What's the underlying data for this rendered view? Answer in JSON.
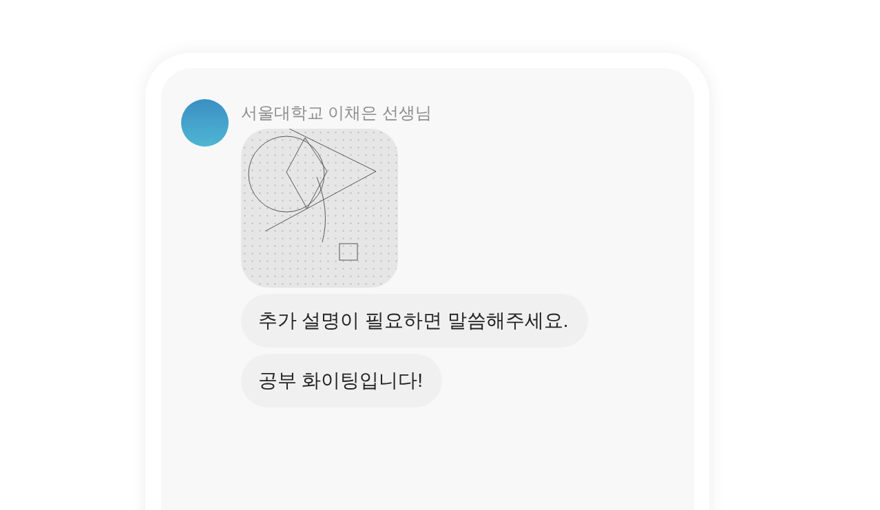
{
  "sender": {
    "name": "서울대학교 이채은 선생님"
  },
  "messages": [
    {
      "kind": "image"
    },
    {
      "kind": "text",
      "text": "추가 설명이 필요하면 말씀해주세요."
    },
    {
      "kind": "text",
      "text": "공부 화이팅입니다!"
    }
  ]
}
